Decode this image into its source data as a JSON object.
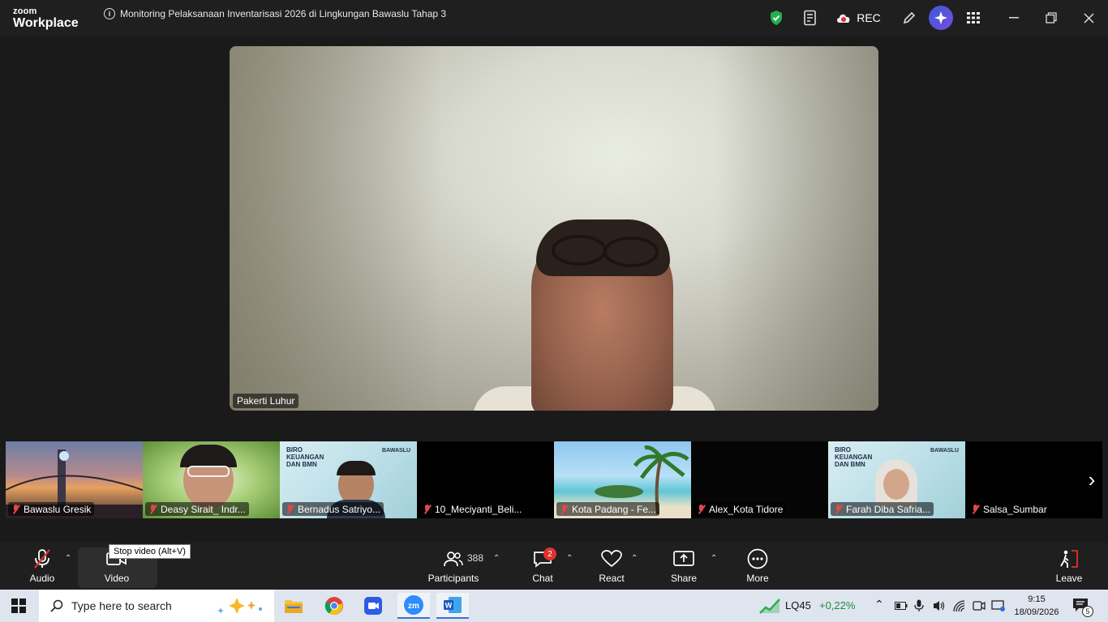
{
  "titlebar": {
    "logo_line1": "zoom",
    "logo_line2": "Workplace",
    "meeting_title": "Monitoring Pelaksanaan Inventarisasi 2026 di Lingkungan Bawaslu Tahap 3",
    "rec_label": "REC"
  },
  "speaker": {
    "name": "Pakerti Luhur"
  },
  "gallery": [
    {
      "name": "Bawaslu Gresik",
      "bg": "bridge"
    },
    {
      "name": "Deasy Sirait_ Indr...",
      "bg": "green"
    },
    {
      "name": "Bernadus Satriyo...",
      "bg": "biro"
    },
    {
      "name": "10_Meciyanti_Beli...",
      "bg": "black"
    },
    {
      "name": "Kota Padang - Fe...",
      "bg": "beach"
    },
    {
      "name": "Alex_Kota Tidore",
      "bg": "black"
    },
    {
      "name": "Farah Diba Safria...",
      "bg": "biro"
    },
    {
      "name": "Salsa_Sumbar",
      "bg": "black"
    }
  ],
  "biro_text": [
    "BIRO",
    "KEUANGAN",
    "DAN BMN"
  ],
  "bawaslu_text": "BAWASLU",
  "toolbar": {
    "audio": "Audio",
    "video": "Video",
    "participants": "Participants",
    "participants_count": "388",
    "chat": "Chat",
    "chat_badge": "2",
    "react": "React",
    "share": "Share",
    "more": "More",
    "leave": "Leave",
    "tooltip": "Stop video (Alt+V)"
  },
  "taskbar": {
    "search_placeholder": "Type here to search",
    "stock_name": "LQ45",
    "stock_change": "+0,22%",
    "time": "9:15",
    "date": "18/09/2026",
    "notif_count": "5"
  }
}
